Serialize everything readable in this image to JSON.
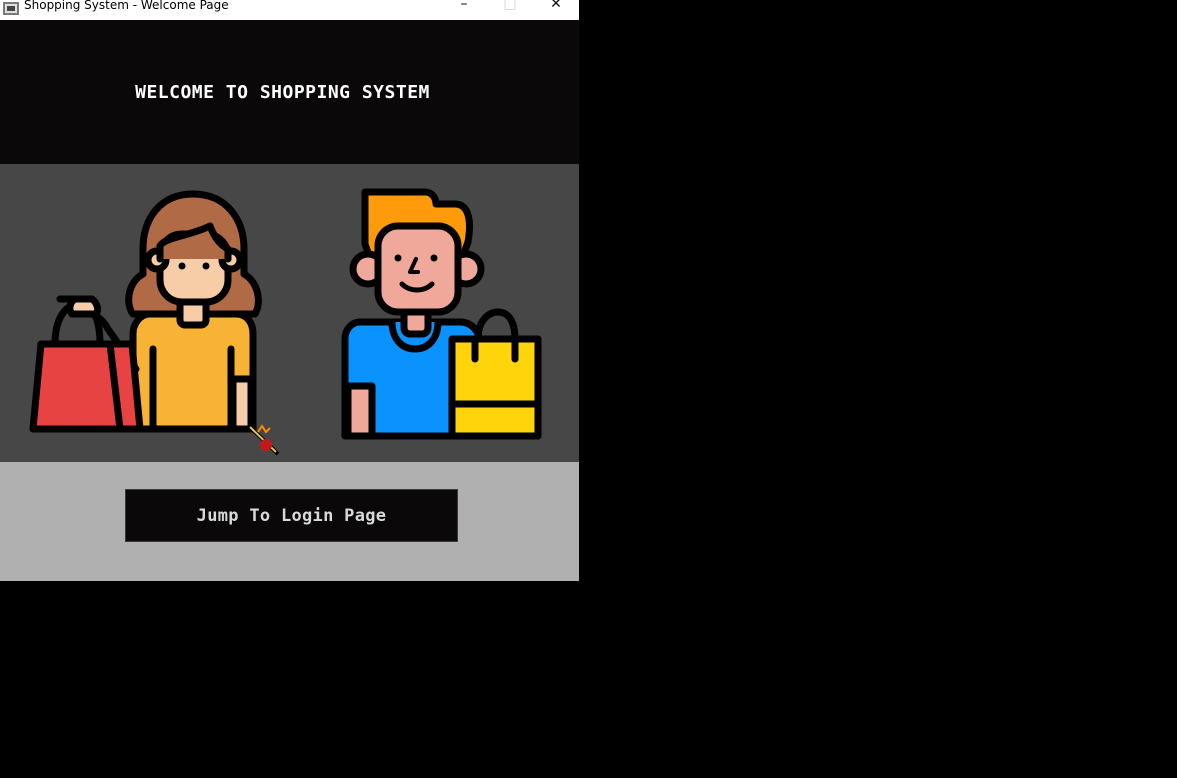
{
  "window": {
    "title": "Shopping System - Welcome Page",
    "controls": {
      "minimize": "–",
      "maximize": "□",
      "close": "✕"
    }
  },
  "header": {
    "title": "WELCOME TO SHOPPING SYSTEM"
  },
  "hero": {
    "figures": [
      "woman-with-red-shopping-bag",
      "man-with-yellow-shopping-bag"
    ],
    "cursor": "busy-cursor-icon"
  },
  "footer": {
    "login_button_label": "Jump To Login Page"
  },
  "colors": {
    "header_bg": "#0a0809",
    "hero_bg": "#474747",
    "footer_bg": "#b0b0b0",
    "button_bg": "#0a0809",
    "desktop_bg": "#000000"
  }
}
